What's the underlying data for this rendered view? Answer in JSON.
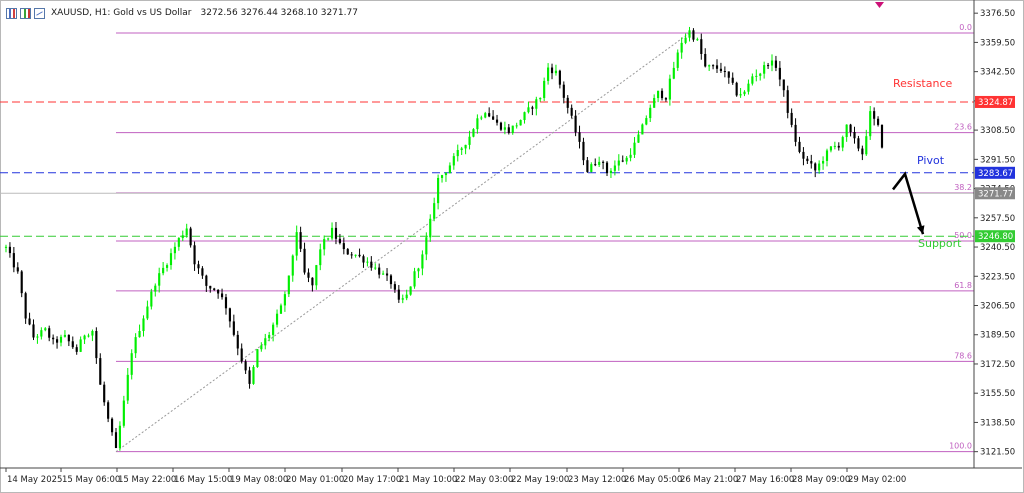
{
  "window": {
    "symbol_line": "XAUUSD, H1:  Gold vs US Dollar",
    "ohlc_line": "3272.56 3276.44 3268.10 3271.77",
    "icons": [
      "bar-chart-icon",
      "candlestick-icon",
      "line-chart-icon"
    ]
  },
  "colors": {
    "bull": "#00ee00",
    "bear": "#000000",
    "fib": "#c060c0",
    "resistance": "#ff3333",
    "pivot": "#2233dd",
    "support": "#33cc33",
    "current": "#888888"
  },
  "chart_data": {
    "type": "candlestick",
    "symbol": "XAUUSD",
    "timeframe": "H1",
    "ylim": [
      3112,
      3383
    ],
    "y_ticks": [
      "3376.50",
      "3359.50",
      "3342.50",
      "3325.50",
      "3308.50",
      "3291.50",
      "3274.50",
      "3257.50",
      "3240.50",
      "3223.50",
      "3206.50",
      "3189.50",
      "3172.50",
      "3155.50",
      "3138.50",
      "3121.50"
    ],
    "x_ticks": [
      "14 May 2025",
      "15 May 06:00",
      "15 May 22:00",
      "16 May 15:00",
      "19 May 08:00",
      "20 May 01:00",
      "20 May 17:00",
      "21 May 10:00",
      "22 May 03:00",
      "22 May 19:00",
      "23 May 12:00",
      "26 May 05:00",
      "26 May 21:00",
      "27 May 16:00",
      "28 May 09:00",
      "29 May 02:00"
    ],
    "candle_count": 224,
    "price_path": [
      [
        0,
        3240
      ],
      [
        3,
        3225
      ],
      [
        5,
        3200
      ],
      [
        7,
        3188
      ],
      [
        10,
        3192
      ],
      [
        12,
        3185
      ],
      [
        15,
        3188
      ],
      [
        18,
        3180
      ],
      [
        20,
        3190
      ],
      [
        22,
        3192
      ],
      [
        24,
        3160
      ],
      [
        26,
        3140
      ],
      [
        28,
        3122
      ],
      [
        30,
        3150
      ],
      [
        32,
        3180
      ],
      [
        35,
        3200
      ],
      [
        38,
        3220
      ],
      [
        41,
        3232
      ],
      [
        44,
        3245
      ],
      [
        46,
        3252
      ],
      [
        48,
        3232
      ],
      [
        51,
        3218
      ],
      [
        54,
        3215
      ],
      [
        56,
        3206
      ],
      [
        58,
        3190
      ],
      [
        60,
        3175
      ],
      [
        62,
        3160
      ],
      [
        64,
        3180
      ],
      [
        67,
        3190
      ],
      [
        70,
        3205
      ],
      [
        72,
        3222
      ],
      [
        74,
        3250
      ],
      [
        76,
        3225
      ],
      [
        78,
        3218
      ],
      [
        80,
        3240
      ],
      [
        83,
        3250
      ],
      [
        86,
        3238
      ],
      [
        89,
        3236
      ],
      [
        92,
        3232
      ],
      [
        95,
        3226
      ],
      [
        98,
        3220
      ],
      [
        100,
        3208
      ],
      [
        102,
        3212
      ],
      [
        104,
        3225
      ],
      [
        106,
        3235
      ],
      [
        108,
        3255
      ],
      [
        110,
        3280
      ],
      [
        112,
        3285
      ],
      [
        115,
        3295
      ],
      [
        118,
        3305
      ],
      [
        120,
        3315
      ],
      [
        122,
        3320
      ],
      [
        125,
        3312
      ],
      [
        128,
        3308
      ],
      [
        130,
        3312
      ],
      [
        133,
        3320
      ],
      [
        136,
        3328
      ],
      [
        138,
        3345
      ],
      [
        140,
        3342
      ],
      [
        142,
        3328
      ],
      [
        144,
        3315
      ],
      [
        146,
        3300
      ],
      [
        148,
        3285
      ],
      [
        151,
        3292
      ],
      [
        153,
        3284
      ],
      [
        156,
        3290
      ],
      [
        158,
        3292
      ],
      [
        160,
        3300
      ],
      [
        162,
        3310
      ],
      [
        164,
        3322
      ],
      [
        166,
        3330
      ],
      [
        168,
        3328
      ],
      [
        170,
        3345
      ],
      [
        172,
        3360
      ],
      [
        174,
        3366
      ],
      [
        176,
        3360
      ],
      [
        178,
        3345
      ],
      [
        180,
        3345
      ],
      [
        182,
        3344
      ],
      [
        184,
        3338
      ],
      [
        186,
        3330
      ],
      [
        188,
        3330
      ],
      [
        190,
        3340
      ],
      [
        192,
        3342
      ],
      [
        194,
        3348
      ],
      [
        196,
        3346
      ],
      [
        198,
        3330
      ],
      [
        200,
        3310
      ],
      [
        202,
        3295
      ],
      [
        204,
        3290
      ],
      [
        206,
        3285
      ],
      [
        208,
        3292
      ],
      [
        210,
        3298
      ],
      [
        212,
        3300
      ],
      [
        214,
        3310
      ],
      [
        216,
        3302
      ],
      [
        218,
        3295
      ],
      [
        220,
        3318
      ],
      [
        222,
        3310
      ],
      [
        223,
        3300
      ]
    ],
    "fib_levels": [
      {
        "label": "0.0",
        "price": 3365.0
      },
      {
        "label": "23.6",
        "price": 3307.0
      },
      {
        "label": "38.2",
        "price": 3272.0
      },
      {
        "label": "50.0",
        "price": 3244.0
      },
      {
        "label": "61.8",
        "price": 3215.0
      },
      {
        "label": "78.6",
        "price": 3174.0
      },
      {
        "label": "100.0",
        "price": 3121.5
      }
    ],
    "horizontal_lines": [
      {
        "name": "Resistance",
        "price": 3324.87,
        "label": "3324.87",
        "style": "dashed"
      },
      {
        "name": "Pivot",
        "price": 3283.67,
        "label": "3283.67",
        "style": "dashed"
      },
      {
        "name": "Support",
        "price": 3246.8,
        "label": "3246.80",
        "style": "dashed"
      }
    ],
    "current_price": {
      "price": 3271.77,
      "label": "3271.77"
    },
    "annotations": {
      "resistance": "Resistance",
      "pivot": "Pivot",
      "support": "Support"
    },
    "trend_line": {
      "from_candle": 28,
      "from_price": 3121.5,
      "to_candle": 174,
      "to_price": 3365.0
    },
    "projection_arrow": {
      "start_price": 3274,
      "peak_price": 3283,
      "end_price": 3248
    }
  }
}
